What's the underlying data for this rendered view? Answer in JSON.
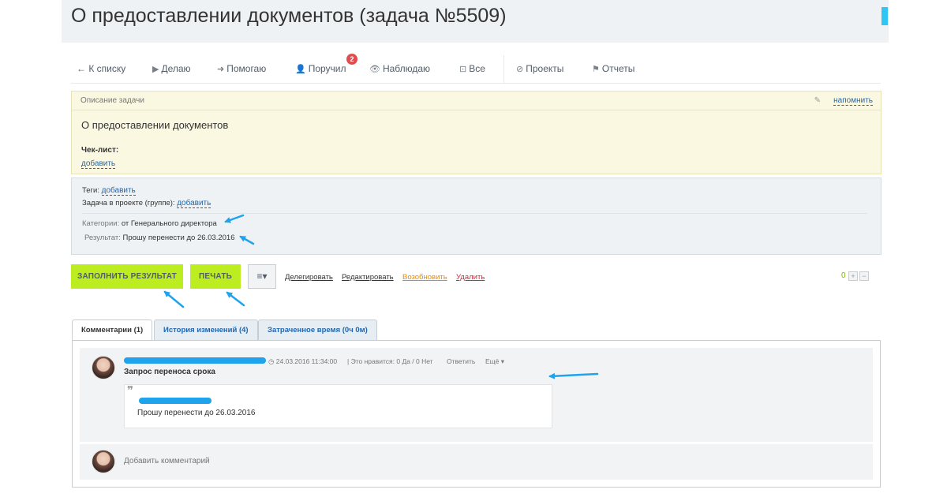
{
  "page": {
    "title": "О предоставлении документов (задача №5509)"
  },
  "nav": {
    "back": "← К списку",
    "doing": "Делаю",
    "helping": "Помогаю",
    "assigned": "Поручил",
    "assigned_badge": "2",
    "watching": "Наблюдаю",
    "all": "Все",
    "projects": "Проекты",
    "reports": "Отчеты"
  },
  "description": {
    "header": "Описание задачи",
    "remind": "напомнить",
    "title": "О предоставлении документов",
    "checklist_label": "Чек-лист:",
    "checklist_add": "добавить"
  },
  "props": {
    "tags_label": "Теги:",
    "tags_add": "добавить",
    "project_label": "Задача в проекте (группе):",
    "project_add": "добавить",
    "category_label": "Категории:",
    "category_value": "от Генерального директора",
    "result_label": "Результат:",
    "result_value": "Прошу перенести до 26.03.2016"
  },
  "actions": {
    "fill_result": "ЗАПОЛНИТЬ РЕЗУЛЬТАТ",
    "print": "ПЕЧАТЬ",
    "menu": "≡▾",
    "delegate": "Делегировать",
    "edit": "Редактировать",
    "resume": "Возобновить",
    "delete": "Удалить",
    "rating": "0",
    "plus": "+",
    "minus": "−",
    "colors": {
      "green": "#bbed21",
      "resume": "#e88a00",
      "delete": "#d3283a",
      "link": "#2067b0"
    }
  },
  "tabs": [
    {
      "label": "Комментарии (1)",
      "active": true
    },
    {
      "label": "История изменений (4)",
      "active": false
    },
    {
      "label": "Затраченное время (0ч 0м)",
      "active": false
    }
  ],
  "comment": {
    "datetime": "◷ 24.03.2016 11:34:00",
    "likes": "| Это нравится:  0 Да / 0 Нет",
    "reply": "Ответить",
    "more": "Ещё ▾",
    "title": "Запрос переноса срока",
    "quote_mark": "❞",
    "quote_text": "Прошу перенести до 26.03.2016"
  },
  "add_comment": {
    "placeholder": "Добавить комментарий"
  },
  "annotation_color": "#1ea3ec"
}
